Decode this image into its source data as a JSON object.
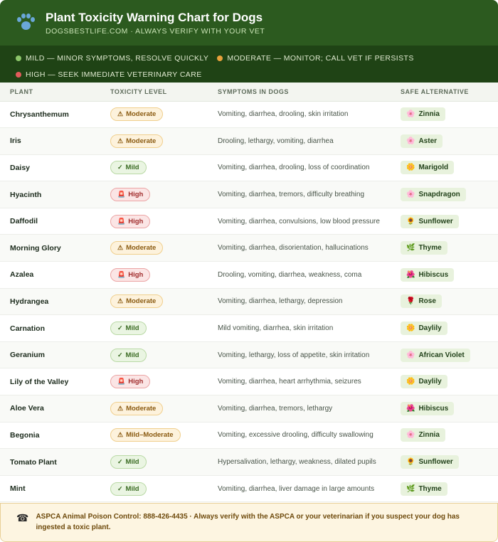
{
  "header": {
    "title": "Plant Toxicity Warning Chart for Dogs",
    "subtitle": "DOGSBESTLIFE.COM · ALWAYS VERIFY WITH YOUR VET",
    "icon": "paw-icon"
  },
  "legend": {
    "mild": "MILD — MINOR SYMPTOMS, RESOLVE QUICKLY",
    "moderate": "MODERATE — MONITOR; CALL VET IF PERSISTS",
    "high": "HIGH — SEEK IMMEDIATE VETERINARY CARE",
    "colors": {
      "mild": "#8cc56a",
      "moderate": "#e8a13c",
      "high": "#e25b5b"
    }
  },
  "table": {
    "columns": [
      "PLANT",
      "TOXICITY LEVEL",
      "SYMPTOMS IN DOGS",
      "SAFE ALTERNATIVE"
    ],
    "rows": [
      {
        "plant": "Chrysanthemum",
        "level": "Moderate",
        "level_icon": "⚠",
        "symptoms": "Vomiting, diarrhea, drooling, skin irritation",
        "alt": "Zinnia",
        "alt_icon": "🌸"
      },
      {
        "plant": "Iris",
        "level": "Moderate",
        "level_icon": "⚠",
        "symptoms": "Drooling, lethargy, vomiting, diarrhea",
        "alt": "Aster",
        "alt_icon": "🌸"
      },
      {
        "plant": "Daisy",
        "level": "Mild",
        "level_icon": "✓",
        "symptoms": "Vomiting, diarrhea, drooling, loss of coordination",
        "alt": "Marigold",
        "alt_icon": "🌼"
      },
      {
        "plant": "Hyacinth",
        "level": "High",
        "level_icon": "🚨",
        "symptoms": "Vomiting, diarrhea, tremors, difficulty breathing",
        "alt": "Snapdragon",
        "alt_icon": "🌸"
      },
      {
        "plant": "Daffodil",
        "level": "High",
        "level_icon": "🚨",
        "symptoms": "Vomiting, diarrhea, convulsions, low blood pressure",
        "alt": "Sunflower",
        "alt_icon": "🌻"
      },
      {
        "plant": "Morning Glory",
        "level": "Moderate",
        "level_icon": "⚠",
        "symptoms": "Vomiting, diarrhea, disorientation, hallucinations",
        "alt": "Thyme",
        "alt_icon": "🌿"
      },
      {
        "plant": "Azalea",
        "level": "High",
        "level_icon": "🚨",
        "symptoms": "Drooling, vomiting, diarrhea, weakness, coma",
        "alt": "Hibiscus",
        "alt_icon": "🌺"
      },
      {
        "plant": "Hydrangea",
        "level": "Moderate",
        "level_icon": "⚠",
        "symptoms": "Vomiting, diarrhea, lethargy, depression",
        "alt": "Rose",
        "alt_icon": "🌹"
      },
      {
        "plant": "Carnation",
        "level": "Mild",
        "level_icon": "✓",
        "symptoms": "Mild vomiting, diarrhea, skin irritation",
        "alt": "Daylily",
        "alt_icon": "🌼"
      },
      {
        "plant": "Geranium",
        "level": "Mild",
        "level_icon": "✓",
        "symptoms": "Vomiting, lethargy, loss of appetite, skin irritation",
        "alt": "African Violet",
        "alt_icon": "🌸"
      },
      {
        "plant": "Lily of the Valley",
        "level": "High",
        "level_icon": "🚨",
        "symptoms": "Vomiting, diarrhea, heart arrhythmia, seizures",
        "alt": "Daylily",
        "alt_icon": "🌼"
      },
      {
        "plant": "Aloe Vera",
        "level": "Moderate",
        "level_icon": "⚠",
        "symptoms": "Vomiting, diarrhea, tremors, lethargy",
        "alt": "Hibiscus",
        "alt_icon": "🌺"
      },
      {
        "plant": "Begonia",
        "level": "Mild–Moderate",
        "level_icon": "⚠",
        "symptoms": "Vomiting, excessive drooling, difficulty swallowing",
        "alt": "Zinnia",
        "alt_icon": "🌸"
      },
      {
        "plant": "Tomato Plant",
        "level": "Mild",
        "level_icon": "✓",
        "symptoms": "Hypersalivation, lethargy, weakness, dilated pupils",
        "alt": "Sunflower",
        "alt_icon": "🌻"
      },
      {
        "plant": "Mint",
        "level": "Mild",
        "level_icon": "✓",
        "symptoms": "Vomiting, diarrhea, liver damage in large amounts",
        "alt": "Thyme",
        "alt_icon": "🌿"
      }
    ]
  },
  "footer": {
    "icon": "phone-icon",
    "text": "ASPCA Animal Poison Control: 888-426-4435 · Always verify with the ASPCA or your veterinarian if you suspect your dog has ingested a toxic plant."
  }
}
